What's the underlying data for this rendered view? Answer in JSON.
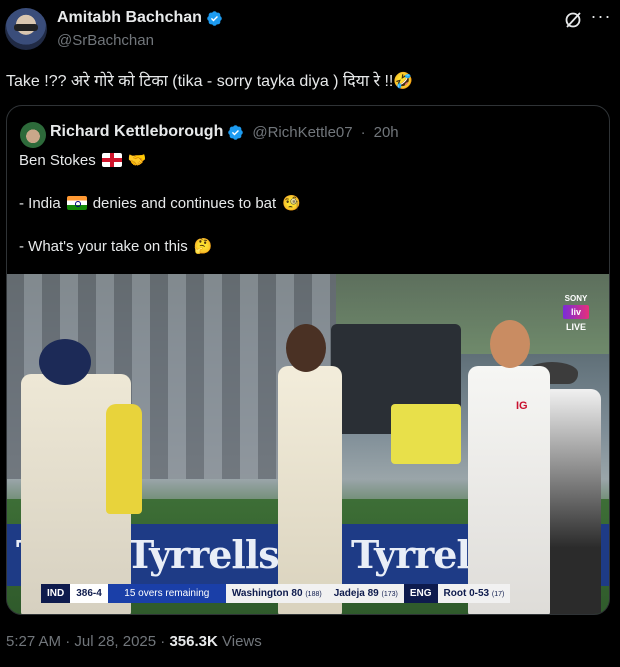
{
  "author": {
    "name": "Amitabh Bachchan",
    "handle": "@SrBachchan",
    "verified": true
  },
  "tweet": {
    "text": "Take  !?? अरे गोरे को टिका (tika - sorry tayka diya ) दिया रे  !!🤣"
  },
  "quoted": {
    "name": "Richard Kettleborough",
    "handle": "@RichKettle07",
    "separator": "·",
    "time": "20h",
    "lines": [
      {
        "text": "Ben Stokes",
        "flag": "england",
        "suffix_emoji": "🤝"
      },
      {
        "text": "- India",
        "flag": "india",
        "rest": "denies and continues to bat",
        "suffix_emoji": "🧐"
      },
      {
        "text": "- What's your take on this",
        "suffix_emoji": "🤔"
      }
    ]
  },
  "media": {
    "sponsor_left": "Te",
    "sponsor_brand": "Tyrrells",
    "broadcaster_top": "SONY",
    "broadcaster_logo": "liv",
    "live_label": "LIVE",
    "shirt_text": "IG",
    "scorebar": {
      "team": "IND",
      "score": "386-4",
      "overs_remaining": "15 overs remaining",
      "batter1": "Washington 80",
      "batter1_balls": "(188)",
      "batter2": "Jadeja 89",
      "batter2_balls": "(173)",
      "bowling_team": "ENG",
      "bowler": "Root 0-53",
      "bowler_overs": "(17)"
    }
  },
  "footer": {
    "time": "5:27 AM",
    "date": "Jul 28, 2025",
    "separator": "·",
    "views_count": "356.3K",
    "views_label": "Views"
  }
}
